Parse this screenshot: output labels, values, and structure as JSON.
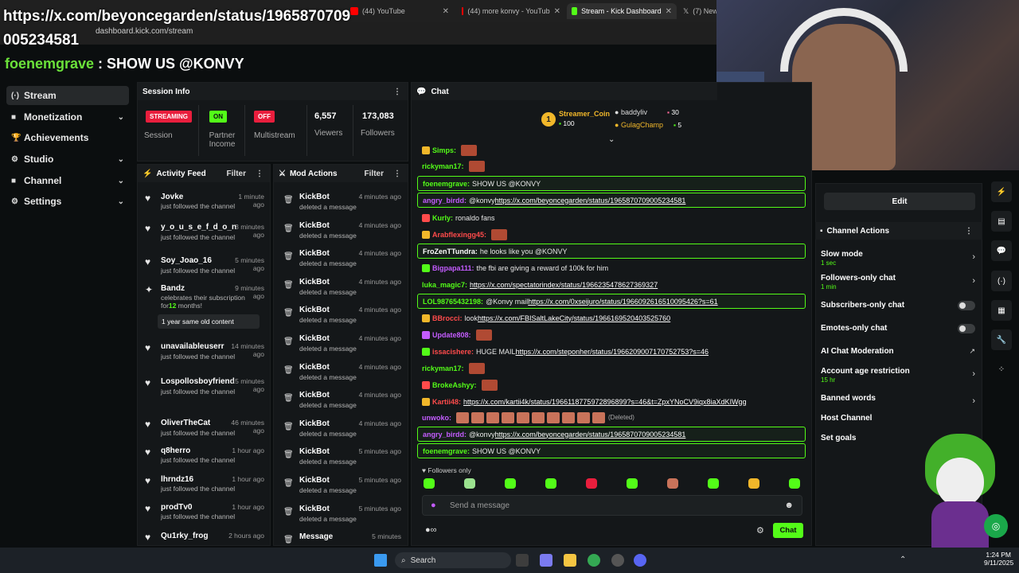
{
  "overlay_url": "https://x.com/beyoncegarden/status/1965870709005234581",
  "browser": {
    "tabs": [
      {
        "label": "(44) YouTube",
        "color": "#ff0000"
      },
      {
        "label": "(44) more konvy - YouTub",
        "color": "#ff0000"
      },
      {
        "label": "Stream - Kick Dashboard",
        "color": "#53fc18",
        "active": true
      },
      {
        "label": "(7) New",
        "color": "#000000"
      }
    ],
    "address": "dashboard.kick.com/stream"
  },
  "title": {
    "username": "foenemgrave",
    "separator": " : ",
    "text": "SHOW US @KONVY"
  },
  "sidebar": {
    "items": [
      {
        "label": "Stream",
        "icon": "broadcast-icon",
        "glyph": "(·)",
        "active": true
      },
      {
        "label": "Monetization",
        "icon": "dollar-icon",
        "glyph": "■",
        "chevron": true
      },
      {
        "label": "Achievements",
        "icon": "trophy-icon",
        "glyph": "🏆"
      },
      {
        "label": "Studio",
        "icon": "sliders-icon",
        "glyph": "⚙",
        "chevron": true
      },
      {
        "label": "Channel",
        "icon": "channel-icon",
        "glyph": "■",
        "chevron": true
      },
      {
        "label": "Settings",
        "icon": "gear-icon",
        "glyph": "⚙",
        "chevron": true
      }
    ]
  },
  "session": {
    "header": "Session Info",
    "streaming_badge": "STREAMING",
    "on_badge": "ON",
    "off_badge": "OFF",
    "session_label": "Session",
    "partner_label": "Partner Income",
    "multistream_label": "Multistream",
    "viewers_value": "6,557",
    "viewers_label": "Viewers",
    "followers_value": "173,083",
    "followers_label": "Followers"
  },
  "activity_feed": {
    "header": "Activity Feed",
    "filter": "Filter",
    "items": [
      {
        "name": "Jovke",
        "sub": "just followed the channel",
        "time": "1 minute ago"
      },
      {
        "name": "y_o_u_s_e_f_d_o_n",
        "sub": "just followed the channel",
        "time": "3 minutes ago"
      },
      {
        "name": "Soy_Joao_16",
        "sub": "just followed the channel",
        "time": "5 minutes ago"
      },
      {
        "name": "Bandz",
        "sub": "celebrates their subscription for",
        "sub_count": "12",
        "sub_tail": " months!",
        "time": "9 minutes ago",
        "note": "1 year same old content"
      },
      {
        "name": "unavailableuserr",
        "sub": "just followed the channel",
        "time": "14 minutes ago"
      },
      {
        "name": "Lospollosboyfriend",
        "sub": "just followed the channel",
        "time": "15 minutes ago"
      },
      {
        "name": "OliverTheCat",
        "sub": "just followed the channel",
        "time": "46 minutes ago"
      },
      {
        "name": "q8herro",
        "sub": "just followed the channel",
        "time": "1 hour ago"
      },
      {
        "name": "lhrndz16",
        "sub": "just followed the channel",
        "time": "1 hour ago"
      },
      {
        "name": "prodTv0",
        "sub": "just followed the channel",
        "time": "1 hour ago"
      },
      {
        "name": "Qu1rky_frog",
        "sub": "",
        "time": "2 hours ago"
      }
    ]
  },
  "mod_actions": {
    "header": "Mod Actions",
    "filter": "Filter",
    "items": [
      {
        "name": "KickBot",
        "sub": "deleted a message",
        "time": "4 minutes ago"
      },
      {
        "name": "KickBot",
        "sub": "deleted a message",
        "time": "4 minutes ago"
      },
      {
        "name": "KickBot",
        "sub": "deleted a message",
        "time": "4 minutes ago"
      },
      {
        "name": "KickBot",
        "sub": "deleted a message",
        "time": "4 minutes ago"
      },
      {
        "name": "KickBot",
        "sub": "deleted a message",
        "time": "4 minutes ago"
      },
      {
        "name": "KickBot",
        "sub": "deleted a message",
        "time": "4 minutes ago"
      },
      {
        "name": "KickBot",
        "sub": "deleted a message",
        "time": "4 minutes ago"
      },
      {
        "name": "KickBot",
        "sub": "deleted a message",
        "time": "4 minutes ago"
      },
      {
        "name": "KickBot",
        "sub": "deleted a message",
        "time": "4 minutes ago"
      },
      {
        "name": "KickBot",
        "sub": "deleted a message",
        "time": "5 minutes ago"
      },
      {
        "name": "KickBot",
        "sub": "deleted a message",
        "time": "5 minutes ago"
      },
      {
        "name": "KickBot",
        "sub": "deleted a message",
        "time": "5 minutes ago"
      },
      {
        "name": "Message",
        "sub": "",
        "time": "5 minutes"
      }
    ]
  },
  "chat": {
    "header": "Chat",
    "leaderboard": {
      "first_name": "Streamer_Coin",
      "first_value": "100",
      "first_rank": "1",
      "second_name": "baddyliv",
      "second_value": "30",
      "third_name": "GulagChamp",
      "third_value": "5"
    },
    "messages": [
      {
        "user": "Simps:",
        "color": "#53fc18",
        "text": "",
        "emote": true
      },
      {
        "user": "rickyman17:",
        "color": "#53fc18",
        "text": "",
        "emote": true
      },
      {
        "user": "foenemgrave:",
        "color": "#53fc18",
        "text": "SHOW US @KONVY",
        "boxed": true
      },
      {
        "user": "angry_birdd:",
        "color": "#c45cff",
        "text": "@konvy ",
        "link": "https://x.com/beyoncegarden/status/1965870709005234581",
        "boxed": true
      },
      {
        "user": "Kurly:",
        "color": "#53fc18",
        "text": "ronaldo fans"
      },
      {
        "user": "Arabflexingg45:",
        "color": "#ff4b4b",
        "text": "",
        "emote": true
      },
      {
        "user": "FroZenTTundra:",
        "color": "#ffffff",
        "text": "he looks like you @KONVY",
        "boxed": true
      },
      {
        "user": "Bigpapa111:",
        "color": "#c45cff",
        "text": "the fbi are giving a reward of 100k for him"
      },
      {
        "user": "luka_magic7:",
        "color": "#53fc18",
        "text": "",
        "link": "https://x.com/spectatorindex/status/1966235478627369327"
      },
      {
        "user": "LOL98765432198:",
        "color": "#53fc18",
        "text": "@Konvy mail ",
        "link": "https://x.com/0xseijuro/status/1966092616510095426?s=61",
        "boxed": true
      },
      {
        "user": "BBrocci:",
        "color": "#ff4b4b",
        "text": "look ",
        "link": "https://x.com/FBISaltLakeCity/status/1966169520403525760"
      },
      {
        "user": "Update808:",
        "color": "#c45cff",
        "text": "",
        "emote": true
      },
      {
        "user": "issacishere:",
        "color": "#ff4b4b",
        "text": "HUGE MAIL ",
        "link": "https://x.com/steponher/status/1966209007170752753?s=46"
      },
      {
        "user": "rickyman17:",
        "color": "#53fc18",
        "text": "",
        "emote": true
      },
      {
        "user": "BrokeAshyy:",
        "color": "#53fc18",
        "text": "",
        "emote": true
      },
      {
        "user": "Kartii48:",
        "color": "#ff4b4b",
        "text": "",
        "link": "https://x.com/kartii4k/status/1966118775972896899?s=46&t=ZpxYNoCV9iqx8iaXdKIWgg"
      },
      {
        "user": "unwoko:",
        "color": "#c45cff",
        "text": "",
        "emotes": 10,
        "deleted": "(Deleted)"
      },
      {
        "user": "angry_birdd:",
        "color": "#c45cff",
        "text": "@konvy ",
        "link": "https://x.com/beyoncegarden/status/1965870709005234581",
        "boxed": true
      },
      {
        "user": "foenemgrave:",
        "color": "#53fc18",
        "text": "SHOW US @KONVY",
        "boxed": true
      }
    ],
    "followers_only": "Followers only",
    "placeholder": "Send a message",
    "send_label": "Chat"
  },
  "channel_actions": {
    "edit_label": "Edit",
    "header": "Channel Actions",
    "items": [
      {
        "title": "Slow mode",
        "sub": "1 sec",
        "control": "chevron"
      },
      {
        "title": "Followers-only chat",
        "sub": "1 min",
        "control": "chevron"
      },
      {
        "title": "Subscribers-only chat",
        "sub": "",
        "control": "toggle"
      },
      {
        "title": "Emotes-only chat",
        "sub": "",
        "control": "toggle"
      },
      {
        "title": "AI Chat Moderation",
        "sub": "",
        "control": "external"
      },
      {
        "title": "Account age restriction",
        "sub": "15 hr",
        "control": "chevron"
      },
      {
        "title": "Banned words",
        "sub": "",
        "control": "chevron"
      },
      {
        "title": "Host Channel",
        "sub": "",
        "control": "none"
      },
      {
        "title": "Set goals",
        "sub": "",
        "control": "none"
      }
    ]
  },
  "taskbar": {
    "search": "Search",
    "time": "1:24 PM",
    "date": "9/11/2025"
  },
  "colors": {
    "accent": "#53fc18",
    "live": "#e91e3d",
    "bg": "#0b0e0f"
  }
}
